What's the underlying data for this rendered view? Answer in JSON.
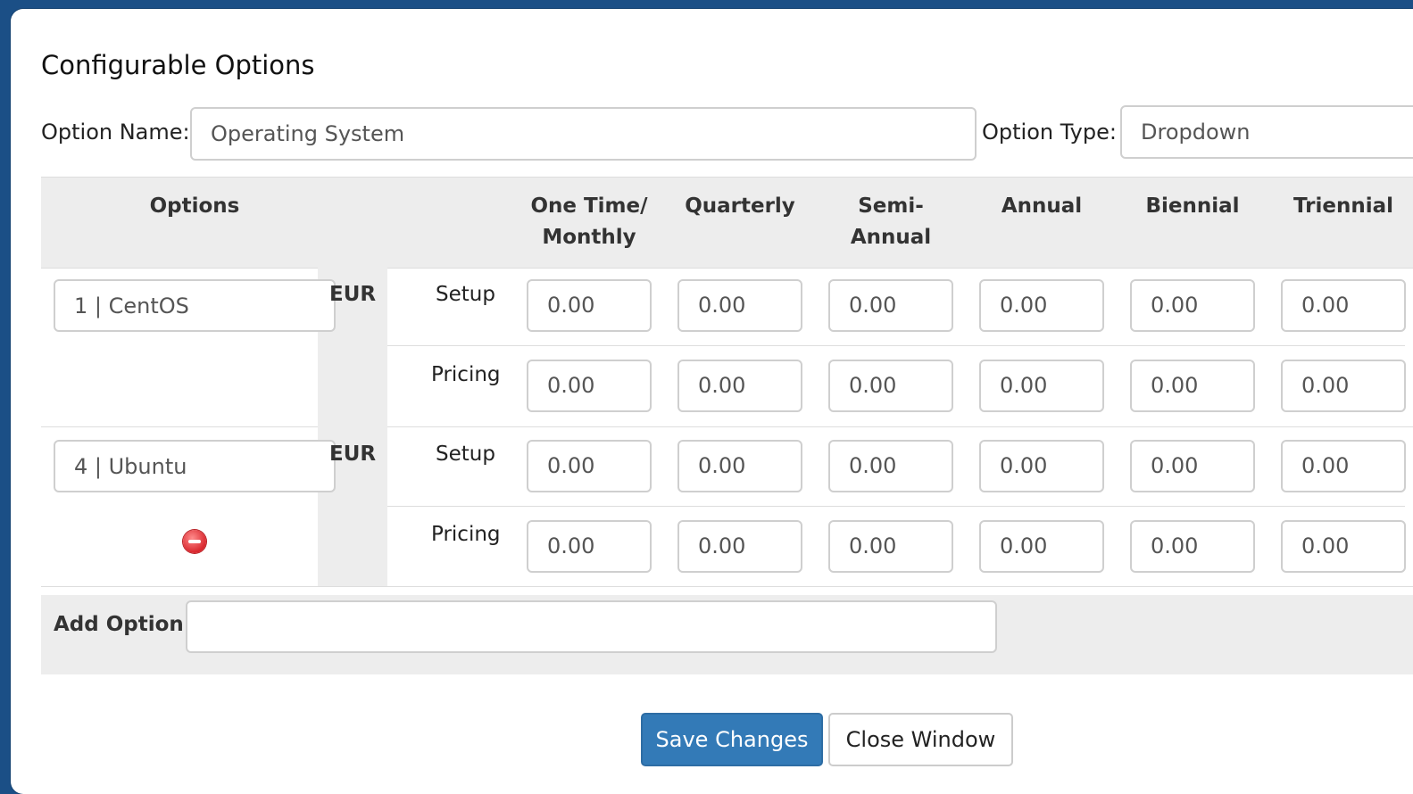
{
  "window": {
    "title": "Configurable Options"
  },
  "form": {
    "option_name_label": "Option Name:",
    "option_name_value": "Operating System",
    "option_type_label": "Option Type:",
    "option_type_value": "Dropdown"
  },
  "table": {
    "options_header": "Options",
    "columns": [
      {
        "line1": "One Time/",
        "line2": "Monthly"
      },
      {
        "line1": "Quarterly",
        "line2": ""
      },
      {
        "line1": "Semi-",
        "line2": "Annual"
      },
      {
        "line1": "Annual",
        "line2": ""
      },
      {
        "line1": "Biennial",
        "line2": ""
      },
      {
        "line1": "Triennial",
        "line2": ""
      }
    ],
    "rows": [
      {
        "option_value": "1 | CentOS",
        "currency": "EUR",
        "setup_label": "Setup",
        "pricing_label": "Pricing",
        "setup": [
          "0.00",
          "0.00",
          "0.00",
          "0.00",
          "0.00",
          "0.00"
        ],
        "pricing": [
          "0.00",
          "0.00",
          "0.00",
          "0.00",
          "0.00",
          "0.00"
        ],
        "removable": false
      },
      {
        "option_value": "4 | Ubuntu",
        "currency": "EUR",
        "setup_label": "Setup",
        "pricing_label": "Pricing",
        "setup": [
          "0.00",
          "0.00",
          "0.00",
          "0.00",
          "0.00",
          "0.00"
        ],
        "pricing": [
          "0.00",
          "0.00",
          "0.00",
          "0.00",
          "0.00",
          "0.00"
        ],
        "removable": true,
        "remove_icon": "remove-circle-icon"
      }
    ]
  },
  "add_option": {
    "label": "Add Option:",
    "value": ""
  },
  "buttons": {
    "save": "Save Changes",
    "close": "Close Window"
  },
  "colors": {
    "primary": "#337ab7",
    "header_bg": "#ededed",
    "frame": "#1b4f86",
    "remove": "#d9272e"
  }
}
